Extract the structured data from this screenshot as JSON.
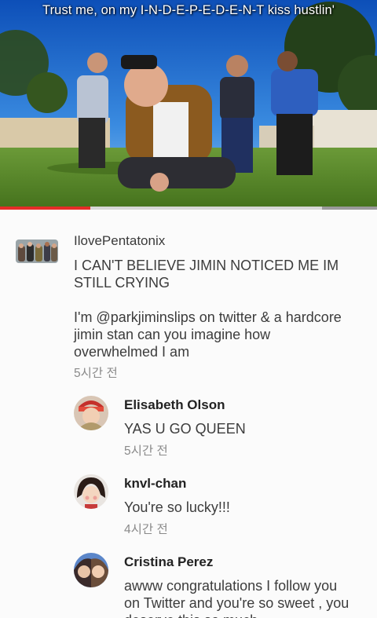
{
  "video": {
    "subtitle": "Trust me, on my I-N-D-E-P-E-D-E-N-T kiss hustlin'",
    "progress": 0.24,
    "buffered": 0.855,
    "colors": {
      "played": "#e52d27",
      "sky": "#1f6fd1",
      "grass": "#5a8a2a"
    }
  },
  "comment": {
    "author": "IlovePentatonix",
    "avatar_icon": "group-photo-avatar-icon",
    "headline_line1": "I CAN'T BELIEVE JIMIN NOTICED ME IM",
    "headline_line2": "STILL CRYING",
    "body_line1": "I'm @parkjiminslips on twitter & a hardcore",
    "body_line2": "jimin stan can you imagine how",
    "body_line3": "overwhelmed I am",
    "time": "5시간 전"
  },
  "replies": [
    {
      "author": "Elisabeth Olson",
      "avatar_icon": "profile-photo-avatar-icon",
      "text_line1": "YAS U GO QUEEN",
      "text_line2": "",
      "text_line3": "",
      "time": "5시간 전"
    },
    {
      "author": "knvl-chan",
      "avatar_icon": "profile-photo-avatar-icon",
      "text_line1": "You're so lucky!!!",
      "text_line2": "",
      "text_line3": "",
      "time": "4시간 전"
    },
    {
      "author": "Cristina Perez",
      "avatar_icon": "profile-photo-avatar-icon",
      "text_line1": "awww congratulations I follow you",
      "text_line2": "on Twitter and you're so sweet , you",
      "text_line3": "deserve this so much"
    }
  ]
}
